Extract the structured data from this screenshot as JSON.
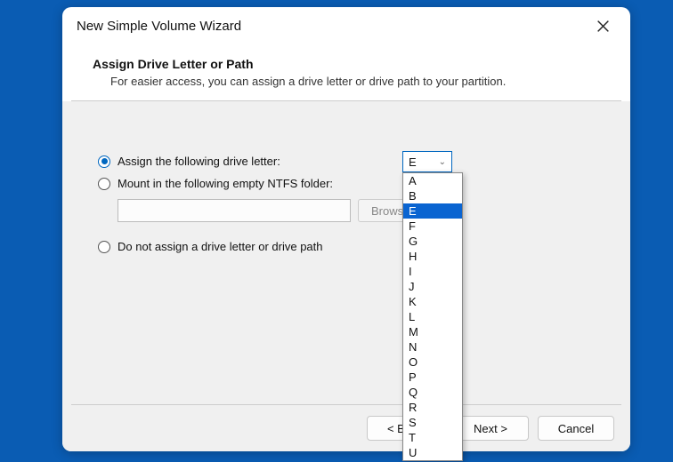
{
  "window": {
    "title": "New Simple Volume Wizard"
  },
  "header": {
    "heading": "Assign Drive Letter or Path",
    "subheading": "For easier access, you can assign a drive letter or drive path to your partition."
  },
  "options": {
    "assign_letter": "Assign the following drive letter:",
    "mount_folder": "Mount in the following empty NTFS folder:",
    "no_assign": "Do not assign a drive letter or drive path"
  },
  "browse_label": "Browse...",
  "drive_select": {
    "value": "E",
    "highlighted": "E",
    "options": [
      "A",
      "B",
      "E",
      "F",
      "G",
      "H",
      "I",
      "J",
      "K",
      "L",
      "M",
      "N",
      "O",
      "P",
      "Q",
      "R",
      "S",
      "T",
      "U"
    ]
  },
  "buttons": {
    "back": "< Back",
    "next": "Next >",
    "cancel": "Cancel"
  }
}
